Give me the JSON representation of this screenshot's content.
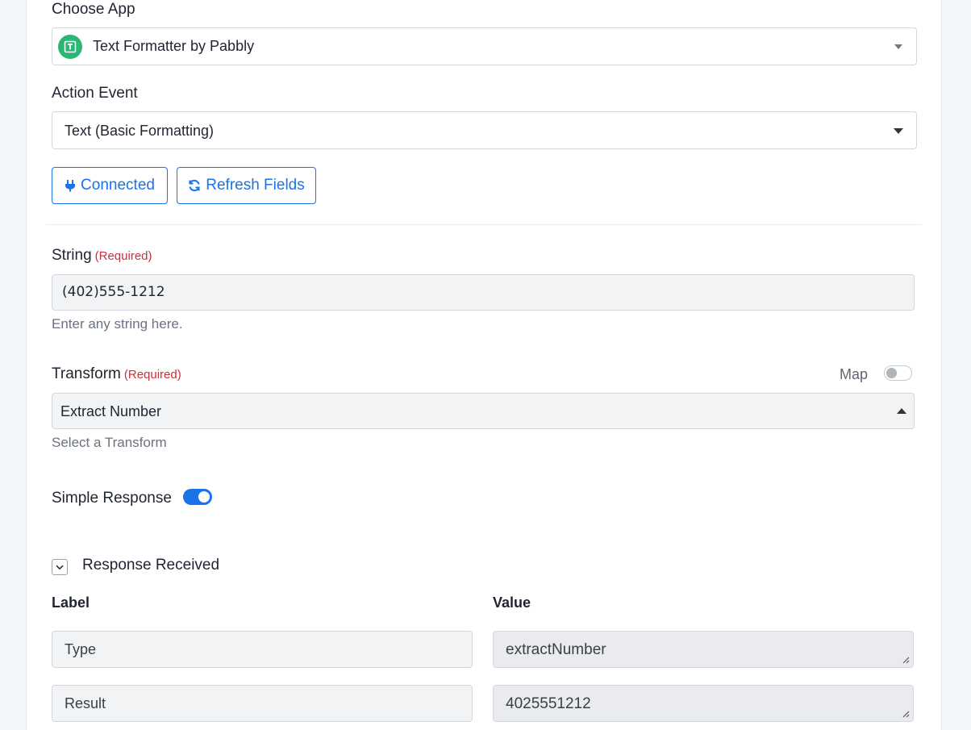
{
  "choose_app": {
    "label": "Choose App",
    "selected": "Text Formatter by Pabbly",
    "icon": "text-formatter-app-icon",
    "icon_color": "#2bb673"
  },
  "action_event": {
    "label": "Action Event",
    "selected": "Text (Basic Formatting)"
  },
  "buttons": {
    "connected": "Connected",
    "refresh": "Refresh Fields",
    "accent": "#1a73e8"
  },
  "string_field": {
    "label": "String",
    "required": "(Required)",
    "value": "(402)555-1212",
    "help": "Enter any string here."
  },
  "transform_field": {
    "label": "Transform",
    "required": "(Required)",
    "map_label": "Map",
    "map_enabled": false,
    "selected": "Extract Number",
    "help": "Select a Transform"
  },
  "simple_response": {
    "label": "Simple Response",
    "enabled": true
  },
  "response": {
    "title": "Response Received",
    "label_header": "Label",
    "value_header": "Value",
    "rows": [
      {
        "label": "Type",
        "value": "extractNumber"
      },
      {
        "label": "Result",
        "value": "4025551212"
      }
    ]
  }
}
